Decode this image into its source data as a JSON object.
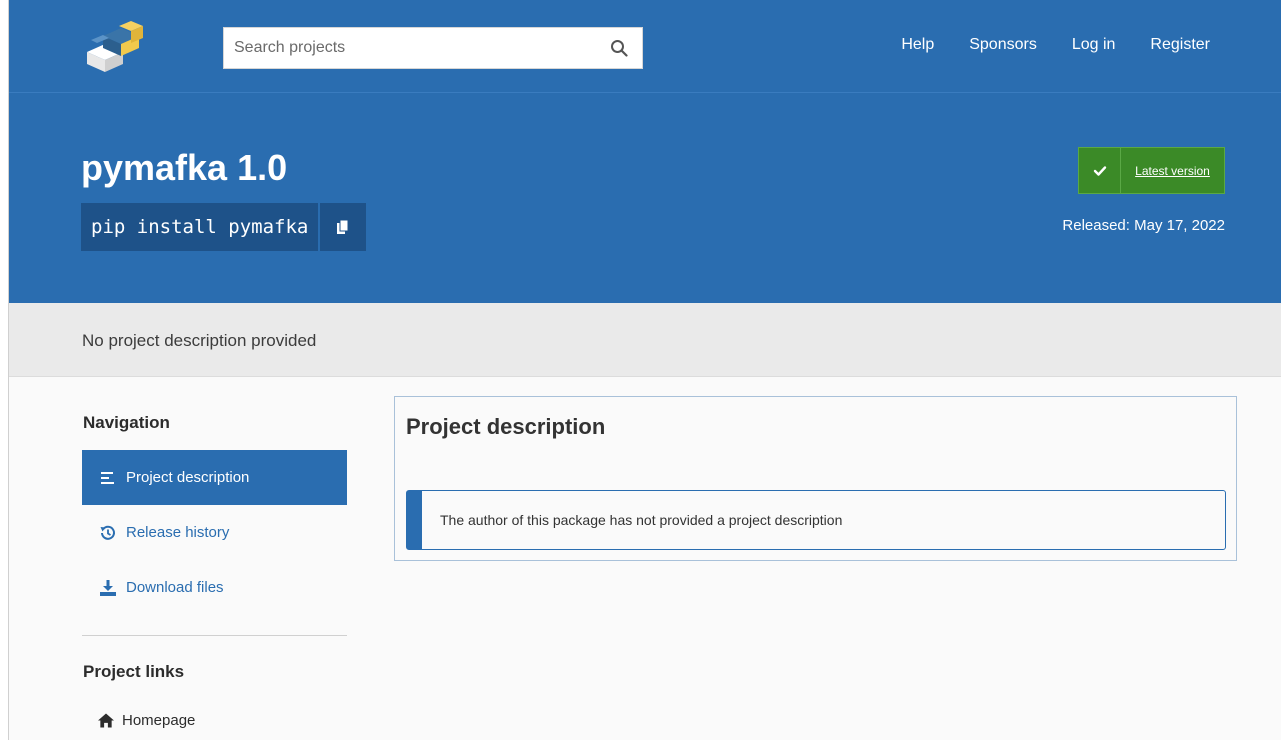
{
  "topbar": {
    "search": {
      "placeholder": "Search projects",
      "value": ""
    },
    "nav": [
      "Help",
      "Sponsors",
      "Log in",
      "Register"
    ]
  },
  "header": {
    "package_title": "pymafka 1.0",
    "pip_command": "pip install pymafka",
    "latest_label": "Latest version",
    "released": "Released: May 17, 2022"
  },
  "summary": {
    "text": "No project description provided"
  },
  "sidebar": {
    "navigation_heading": "Navigation",
    "items": [
      {
        "label": "Project description",
        "icon": "align-left-icon",
        "active": true
      },
      {
        "label": "Release history",
        "icon": "history-icon",
        "active": false
      },
      {
        "label": "Download files",
        "icon": "download-icon",
        "active": false
      }
    ],
    "links_heading": "Project links",
    "links": [
      {
        "label": "Homepage",
        "icon": "home-icon"
      }
    ]
  },
  "main": {
    "title": "Project description",
    "notice": "The author of this package has not provided a project description"
  },
  "colors": {
    "brand_blue": "#2a6db0",
    "dark_blue": "#1e5289",
    "success_green": "#3b8a27"
  }
}
